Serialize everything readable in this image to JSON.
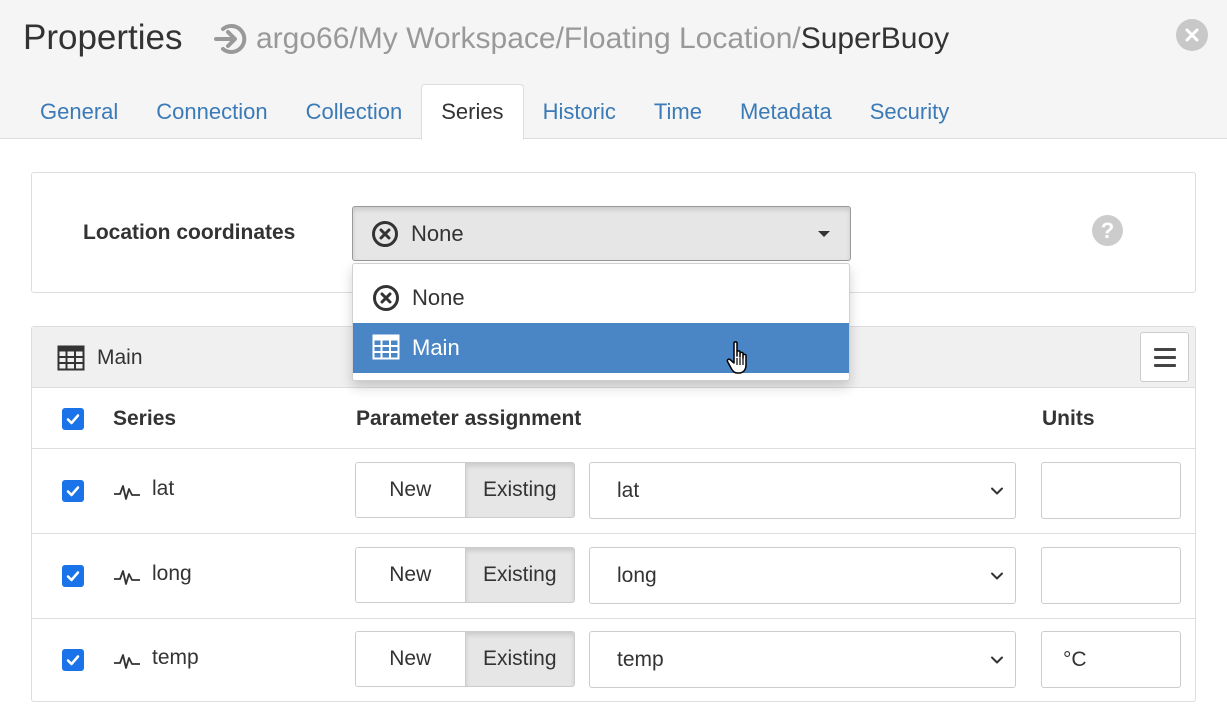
{
  "header": {
    "title": "Properties",
    "breadcrumb_path": "argo66/My Workspace/Floating Location/",
    "breadcrumb_current": "SuperBuoy"
  },
  "tabs": [
    {
      "label": "General",
      "active": false
    },
    {
      "label": "Connection",
      "active": false
    },
    {
      "label": "Collection",
      "active": false
    },
    {
      "label": "Series",
      "active": true
    },
    {
      "label": "Historic",
      "active": false
    },
    {
      "label": "Time",
      "active": false
    },
    {
      "label": "Metadata",
      "active": false
    },
    {
      "label": "Security",
      "active": false
    }
  ],
  "location": {
    "label": "Location coordinates",
    "selected": "None",
    "options": [
      {
        "label": "None",
        "icon": "x-circle-icon"
      },
      {
        "label": "Main",
        "icon": "table-icon",
        "highlighted": true
      }
    ]
  },
  "main_panel": {
    "title": "Main",
    "columns": {
      "series": "Series",
      "parameter": "Parameter assignment",
      "units": "Units"
    },
    "rows": [
      {
        "name": "lat",
        "checked": true,
        "new_label": "New",
        "existing_label": "Existing",
        "mode": "Existing",
        "parameter": "lat",
        "units": ""
      },
      {
        "name": "long",
        "checked": true,
        "new_label": "New",
        "existing_label": "Existing",
        "mode": "Existing",
        "parameter": "long",
        "units": ""
      },
      {
        "name": "temp",
        "checked": true,
        "new_label": "New",
        "existing_label": "Existing",
        "mode": "Existing",
        "parameter": "temp",
        "units": "°C"
      }
    ]
  },
  "colors": {
    "accent": "#3a7ab7",
    "highlight": "#4a86c5",
    "checkbox": "#1a73e8"
  }
}
